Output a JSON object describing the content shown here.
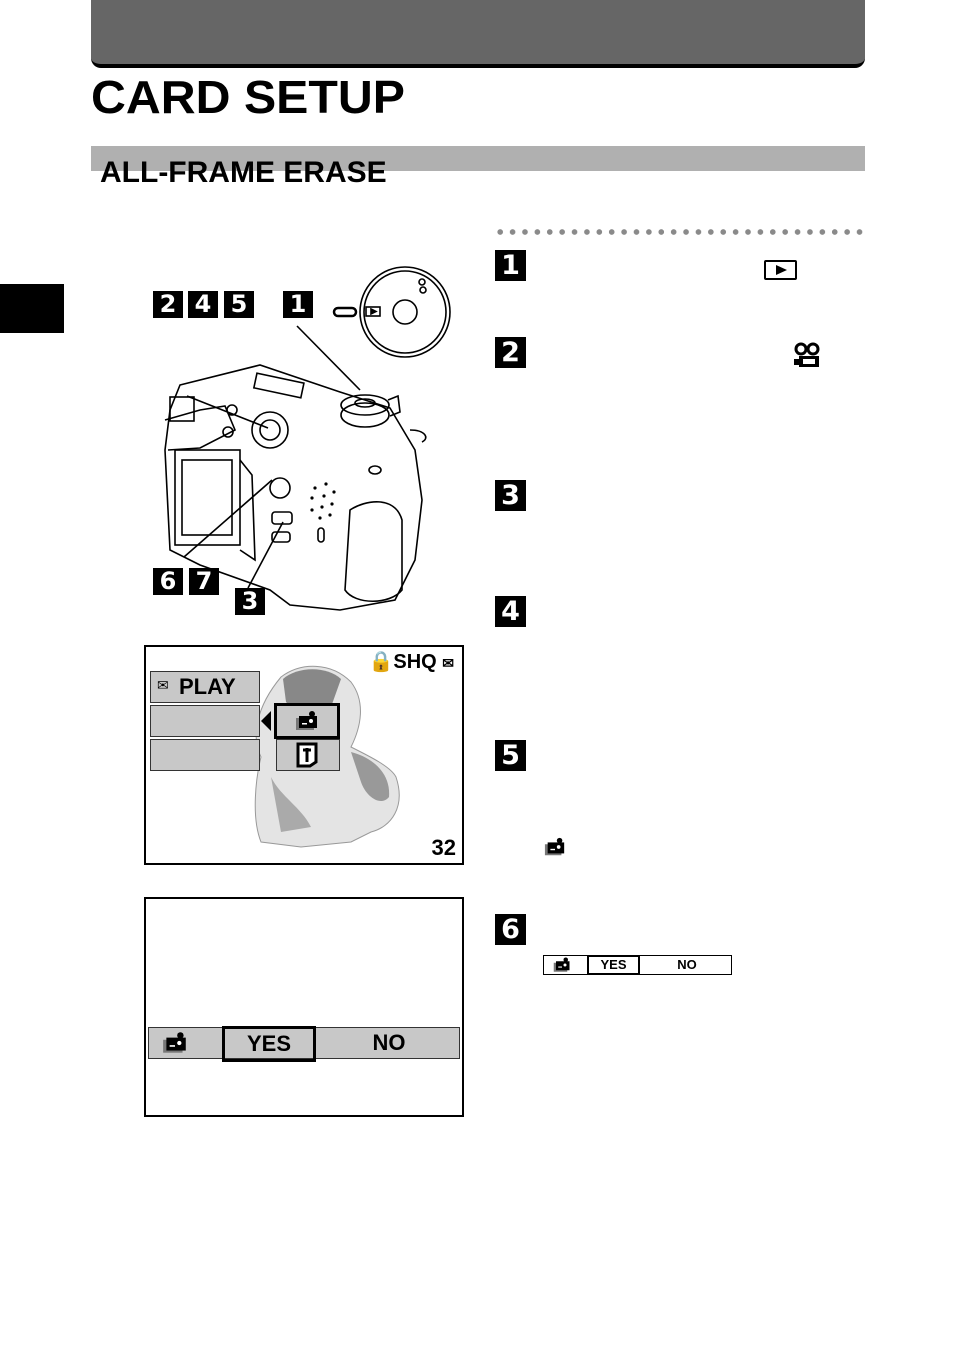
{
  "header": {
    "page_title": "CARD SETUP",
    "section_title": "ALL-FRAME ERASE"
  },
  "callouts": {
    "group_a": [
      "2",
      "4",
      "5"
    ],
    "group_b": [
      "1"
    ],
    "group_c": [
      "6",
      "7"
    ],
    "group_d": [
      "3"
    ]
  },
  "steps": [
    {
      "number": "1",
      "icon": "play-mode-icon"
    },
    {
      "number": "2",
      "icon": "movie-camera-icon"
    },
    {
      "number": "3"
    },
    {
      "number": "4"
    },
    {
      "number": "5",
      "icon": "card-erase-icon"
    },
    {
      "number": "6",
      "inline_dialog": {
        "icon": "card-erase-icon",
        "yes": "YES",
        "no": "NO",
        "selected": "YES"
      }
    }
  ],
  "lcd_menu": {
    "status": "SHQ",
    "mode_label": "PLAY",
    "frame_count": "32",
    "selected_option": "card-erase-icon",
    "other_option": "card-setup-icon"
  },
  "lcd_confirm": {
    "yes": "YES",
    "no": "NO",
    "selected": "YES"
  },
  "colors": {
    "top_bar": "#666666",
    "section_bar": "#b0b0b0",
    "menu_cell": "#c8c8c8",
    "dots": "#8a8a8a"
  }
}
